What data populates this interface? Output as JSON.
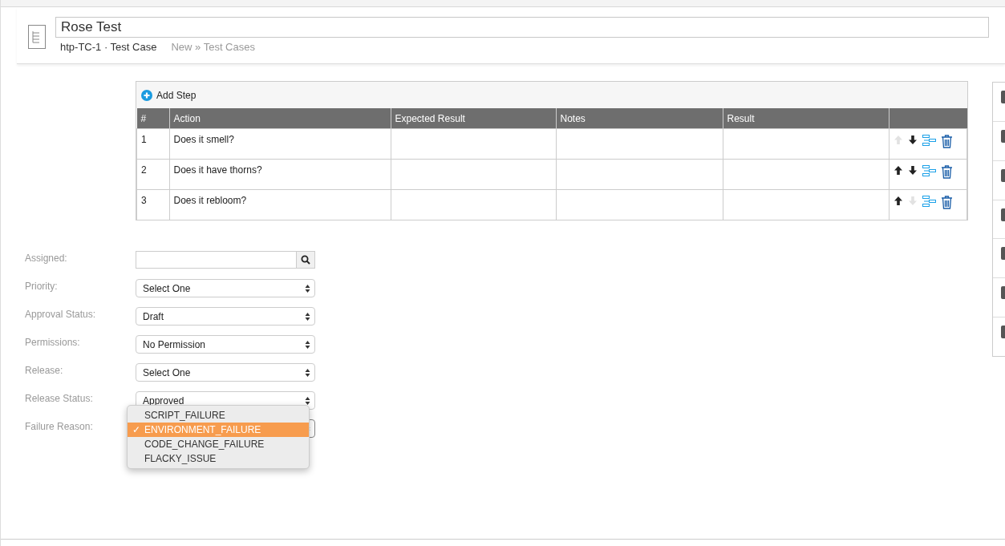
{
  "header": {
    "title": "Rose Test",
    "id_type": "htp-TC-1 · Test Case",
    "breadcrumb": "New » Test Cases"
  },
  "steps": {
    "add_label": "Add Step",
    "columns": [
      "#",
      "Action",
      "Expected Result",
      "Notes",
      "Result"
    ],
    "rows": [
      {
        "number": "1",
        "action": "Does it smell?",
        "up_enabled": false,
        "down_enabled": true
      },
      {
        "number": "2",
        "action": "Does it have thorns?",
        "up_enabled": true,
        "down_enabled": true
      },
      {
        "number": "3",
        "action": "Does it rebloom?",
        "up_enabled": true,
        "down_enabled": false
      }
    ]
  },
  "fields": [
    {
      "label": "Assigned:",
      "kind": "lookup"
    },
    {
      "label": "Priority:",
      "kind": "select",
      "value": "Select One"
    },
    {
      "label": "Approval Status:",
      "kind": "select",
      "value": "Draft"
    },
    {
      "label": "Permissions:",
      "kind": "select",
      "value": "No Permission"
    },
    {
      "label": "Release:",
      "kind": "select",
      "value": "Select One"
    },
    {
      "label": "Release Status:",
      "kind": "select",
      "value": "Approved"
    },
    {
      "label": "Failure Reason:",
      "kind": "select",
      "open": true
    }
  ],
  "dropdown": {
    "options": [
      {
        "label": "SCRIPT_FAILURE",
        "selected": false
      },
      {
        "label": "ENVIRONMENT_FAILURE",
        "selected": true
      },
      {
        "label": "CODE_CHANGE_FAILURE",
        "selected": false
      },
      {
        "label": "FLACKY_ISSUE",
        "selected": false
      }
    ],
    "check": "✓"
  }
}
